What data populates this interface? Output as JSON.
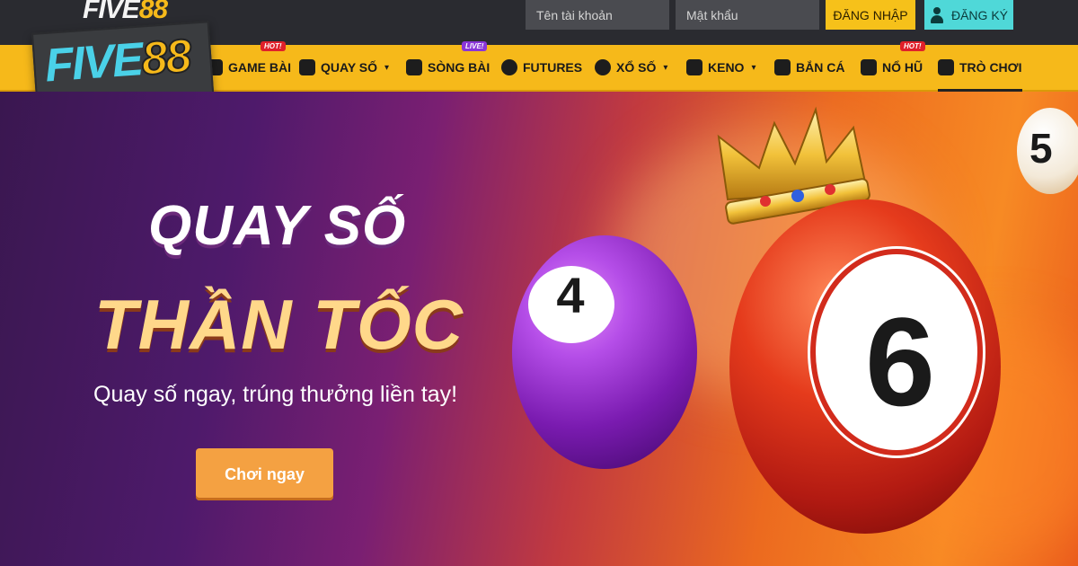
{
  "brand": {
    "small_logo": {
      "five": "FIVE",
      "num": "88"
    },
    "logo": {
      "five": "FIVE",
      "num": "88"
    }
  },
  "topbar": {
    "username_placeholder": "Tên tài khoản",
    "password_placeholder": "Mật khẩu",
    "login_label": "ĐĂNG NHẬP",
    "register_label": "ĐĂNG KÝ"
  },
  "nav": {
    "items": [
      {
        "label": "GAME BÀI",
        "badge": "HOT!",
        "badge_type": "hot",
        "icon": "cards-icon"
      },
      {
        "label": "QUAY SỐ",
        "dropdown": true,
        "icon": "dice-icon"
      },
      {
        "label": "SÒNG BÀI",
        "badge": "LIVE!",
        "badge_type": "live",
        "icon": "casino-icon"
      },
      {
        "label": "FUTURES",
        "icon": "bitcoin-icon"
      },
      {
        "label": "XỔ SỐ",
        "dropdown": true,
        "icon": "lottery-ball-icon"
      },
      {
        "label": "KENO",
        "dropdown": true,
        "icon": "keno-grid-icon"
      },
      {
        "label": "BẮN CÁ",
        "icon": "fish-icon"
      },
      {
        "label": "NỔ HŨ",
        "badge": "HOT!",
        "badge_type": "hot",
        "icon": "slot-machine-icon"
      },
      {
        "label": "TRÒ CHƠI",
        "active": true,
        "icon": "gamepad-icon"
      }
    ]
  },
  "hero": {
    "title_line1": "QUAY SỐ",
    "title_line2": "THẦN TỐC",
    "subtitle": "Quay số ngay, trúng thưởng liền tay!",
    "cta_label": "Chơi ngay",
    "balls": {
      "purple": "4",
      "red": "6",
      "small": "5"
    }
  },
  "colors": {
    "nav_bg": "#f6b91a",
    "login_button": "#f6c11a",
    "register_button": "#4fd8d8",
    "cta": "#f4a142",
    "logo_cyan": "#4ad1e8"
  }
}
